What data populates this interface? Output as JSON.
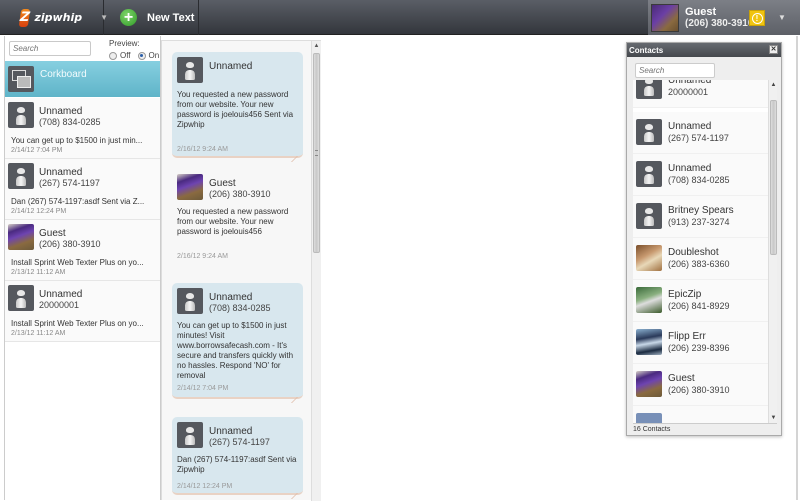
{
  "topbar": {
    "brand_logo": "Z",
    "brand_name": "zipwhip",
    "new_text_label": "New Text",
    "user": {
      "name": "Guest",
      "phone": "(206) 380-3910"
    },
    "alert_glyph": "!"
  },
  "left_panel": {
    "search_placeholder": "Search",
    "preview_label": "Preview:",
    "preview_off": "Off",
    "preview_on": "On",
    "preview_selected": "On",
    "corkboard_label": "Corkboard",
    "conversations": [
      {
        "name": "Unnamed",
        "phone": "(708) 834-0285",
        "snippet": "You can get up to $1500 in just min...",
        "time": "2/14/12 7:04 PM",
        "avatar": "generic-avatar-icon"
      },
      {
        "name": "Unnamed",
        "phone": "(267) 574-1197",
        "snippet": "Dan (267) 574-1197:asdf Sent via Z...",
        "time": "2/14/12 12:24 PM",
        "avatar": "generic-avatar-icon"
      },
      {
        "name": "Guest",
        "phone": "(206) 380-3910",
        "snippet": "Install Sprint Web Texter Plus on yo...",
        "time": "2/13/12 11:12 AM",
        "avatar": "photo-avatar"
      },
      {
        "name": "Unnamed",
        "phone": "20000001",
        "snippet": "Install Sprint Web Texter Plus on yo...",
        "time": "2/13/12 11:12 AM",
        "avatar": "generic-avatar-icon"
      }
    ]
  },
  "messages": [
    {
      "direction": "in",
      "name": "Unnamed",
      "phone": "",
      "body": "You requested a new password from our website. Your new password is joelouis456 Sent via Zipwhip",
      "time": "2/16/12 9:24 AM"
    },
    {
      "direction": "out",
      "name": "Guest",
      "phone": "(206) 380-3910",
      "body": "You requested a new password from our website. Your new password is joelouis456",
      "time": "2/16/12 9:24 AM"
    },
    {
      "direction": "in",
      "name": "Unnamed",
      "phone": "(708) 834-0285",
      "body": "You can get up to $1500 in just minutes! Visit www.borrowsafecash.com - It's secure and transfers quickly with no hassles. Respond 'NO' for removal",
      "time": "2/14/12 7:04 PM"
    },
    {
      "direction": "in",
      "name": "Unnamed",
      "phone": "(267) 574-1197",
      "body": "Dan (267) 574-1197:asdf Sent via Zipwhip",
      "time": "2/14/12 12:24 PM"
    }
  ],
  "contacts": {
    "title": "Contacts",
    "close_glyph": "✕",
    "search_placeholder": "Search",
    "items": [
      {
        "name": "Unnamed",
        "phone": "20000001",
        "avatar": "generic"
      },
      {
        "name": "Unnamed",
        "phone": "(267) 574-1197",
        "avatar": "generic"
      },
      {
        "name": "Unnamed",
        "phone": "(708) 834-0285",
        "avatar": "generic"
      },
      {
        "name": "Britney Spears",
        "phone": "(913) 237-3274",
        "avatar": "generic"
      },
      {
        "name": "Doubleshot",
        "phone": "(206) 383-6360",
        "avatar": "doubleshot"
      },
      {
        "name": "EpicZip",
        "phone": "(206) 841-8929",
        "avatar": "epiczip"
      },
      {
        "name": "Flipp Err",
        "phone": "(206) 239-8396",
        "avatar": "flipp"
      },
      {
        "name": "Guest",
        "phone": "(206) 380-3910",
        "avatar": "guest"
      }
    ],
    "footer": "16 Contacts"
  }
}
